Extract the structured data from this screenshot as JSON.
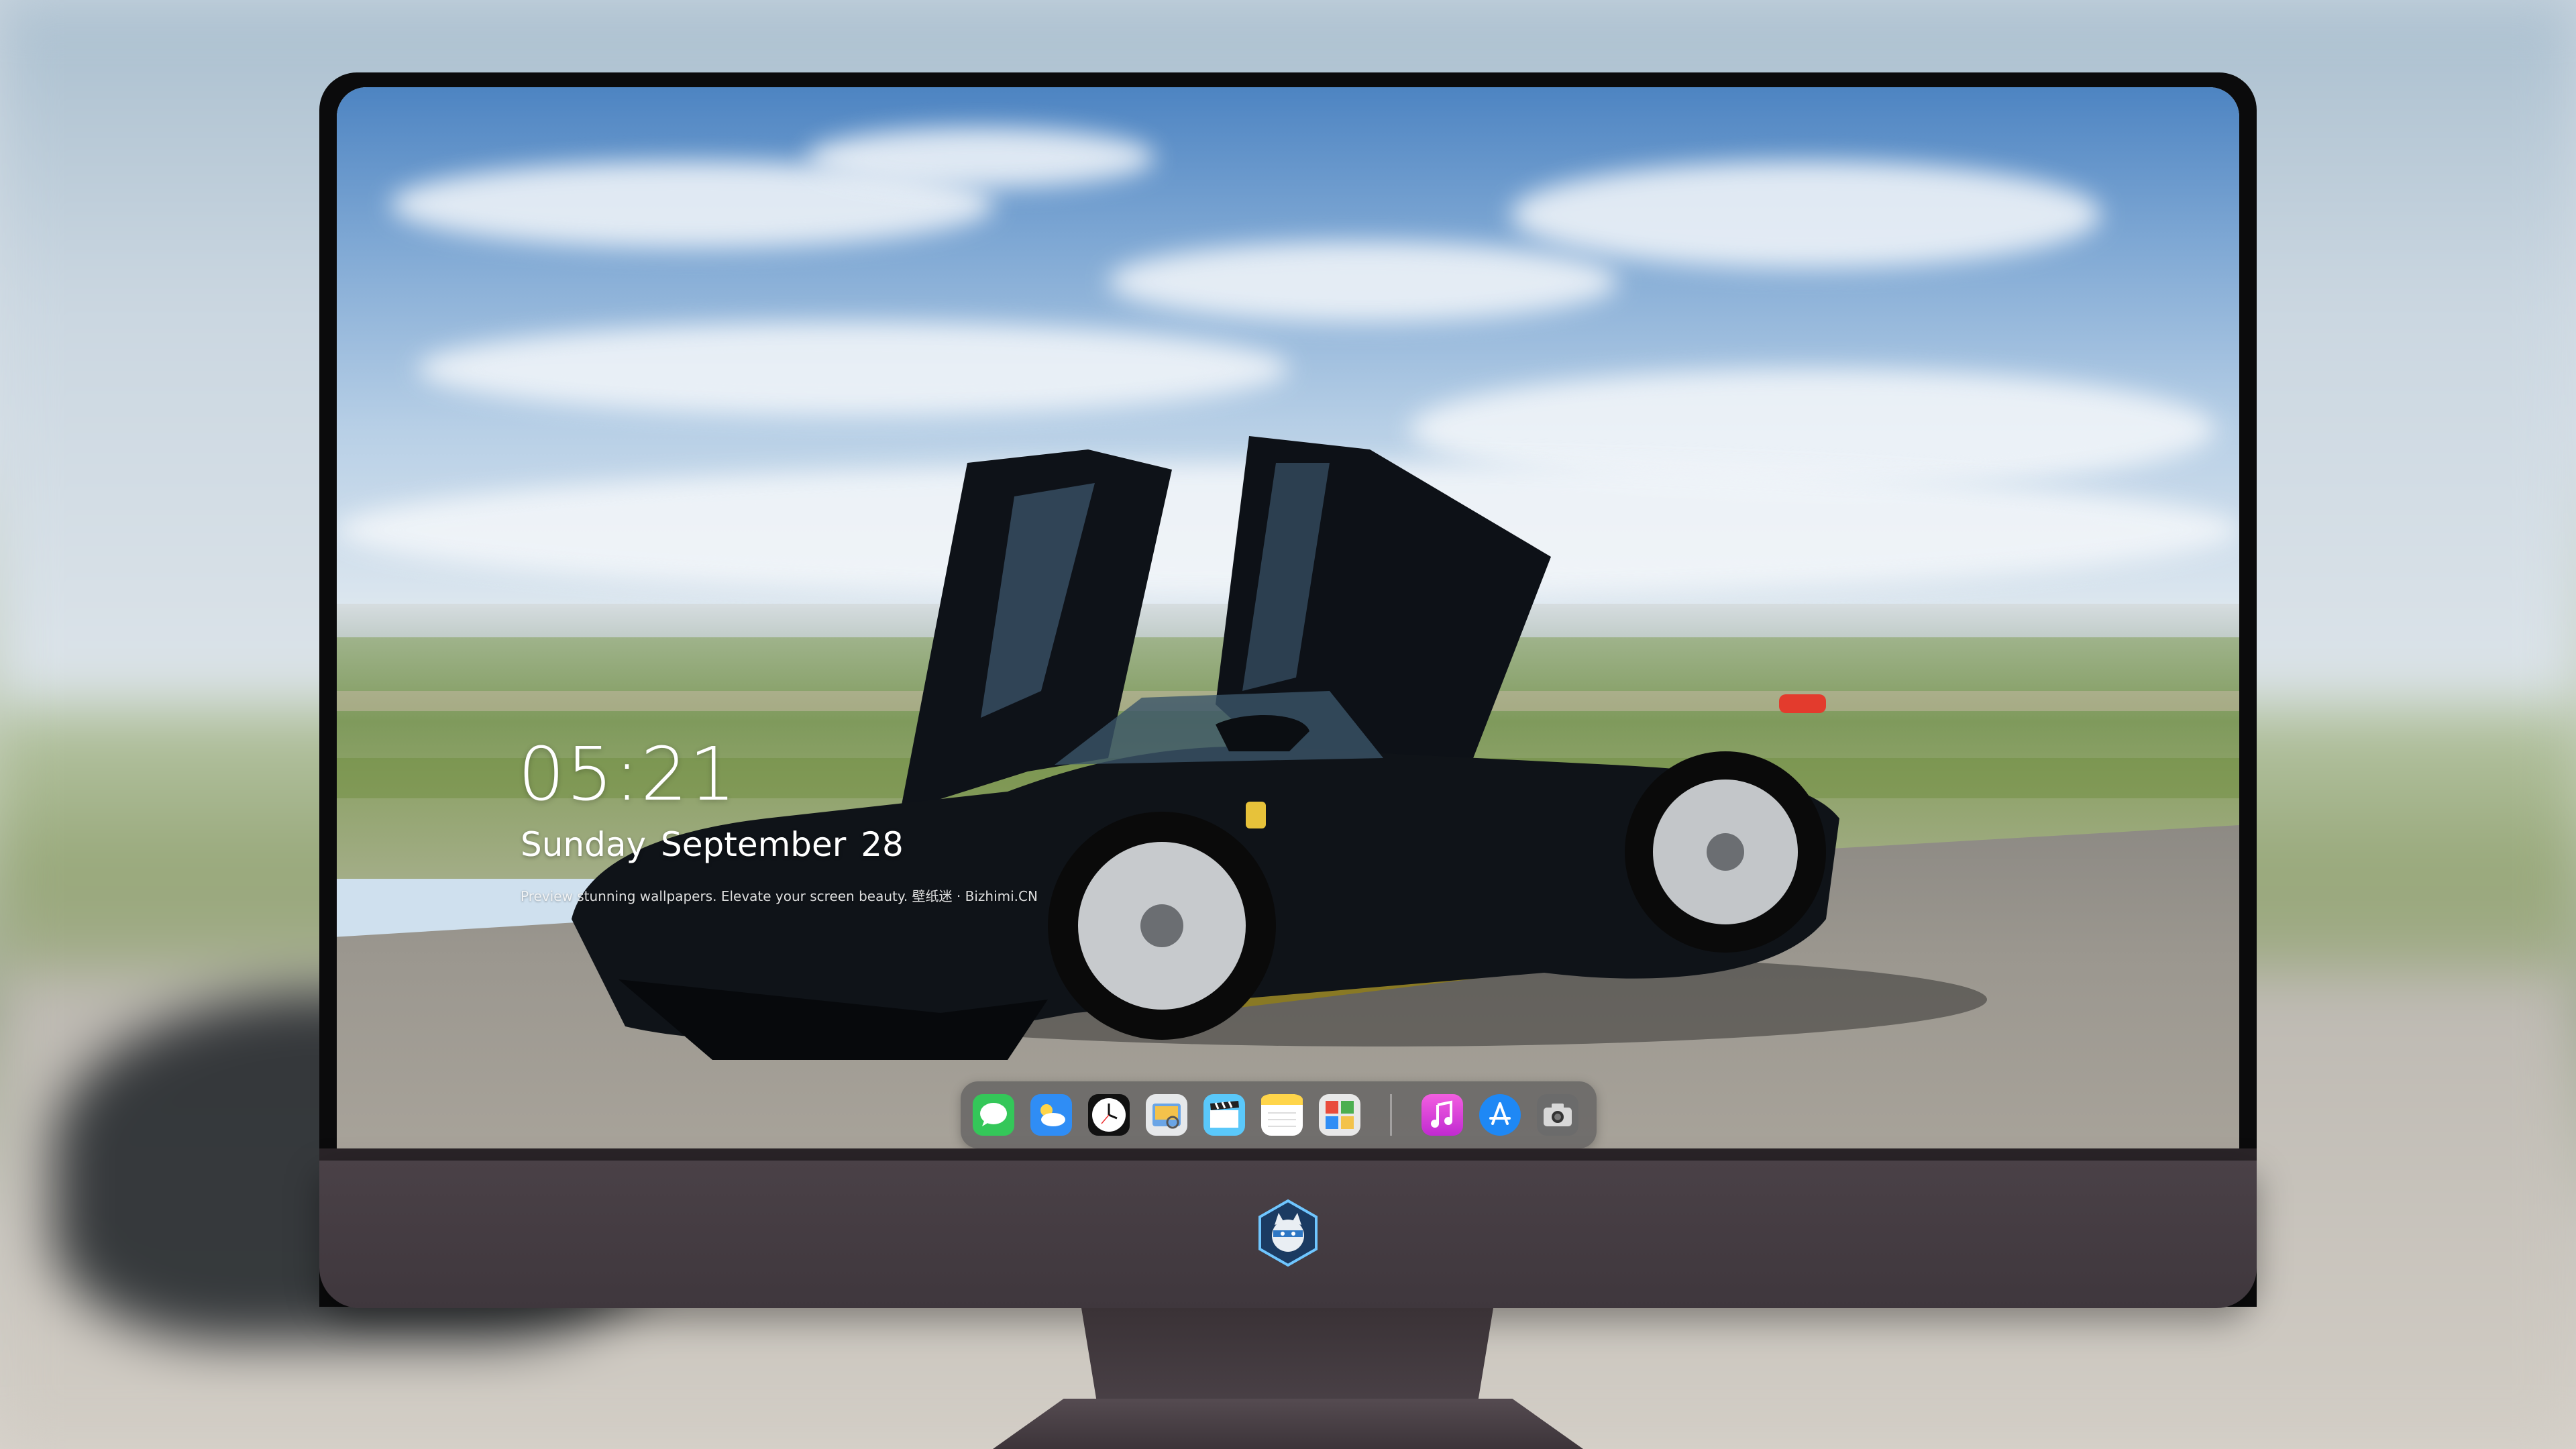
{
  "lockscreen": {
    "time": "05:21",
    "date": "Sunday September  28",
    "tagline": "Preview stunning wallpapers. Elevate your screen beauty. 壁纸迷 · Bizhimi.CN"
  },
  "dock": {
    "apps": [
      {
        "name": "messages",
        "icon": "messages-icon",
        "color": "#34c759"
      },
      {
        "name": "weather",
        "icon": "weather-icon",
        "color": "#2f8df5"
      },
      {
        "name": "clock",
        "icon": "clock-icon",
        "color": "#111111"
      },
      {
        "name": "preview",
        "icon": "preview-icon",
        "color": "#e6e8ea"
      },
      {
        "name": "video-clips",
        "icon": "clapperboard-icon",
        "color": "#5ac8fa"
      },
      {
        "name": "notes",
        "icon": "notes-icon",
        "color": "#ffd54a"
      },
      {
        "name": "photo-booth",
        "icon": "photo-booth-icon",
        "color": "#e8e8e8"
      },
      {
        "name": "itunes",
        "icon": "music-note-icon",
        "color": "#e23bd0"
      },
      {
        "name": "app-store",
        "icon": "app-store-icon",
        "color": "#1e88f5"
      },
      {
        "name": "camera",
        "icon": "camera-icon",
        "color": "#6b6b6b"
      }
    ]
  },
  "monitor": {
    "logo_icon": "ninja-cat-logo-icon",
    "bezel_color": "#0b0b0c",
    "chin_color": "#453c42"
  }
}
